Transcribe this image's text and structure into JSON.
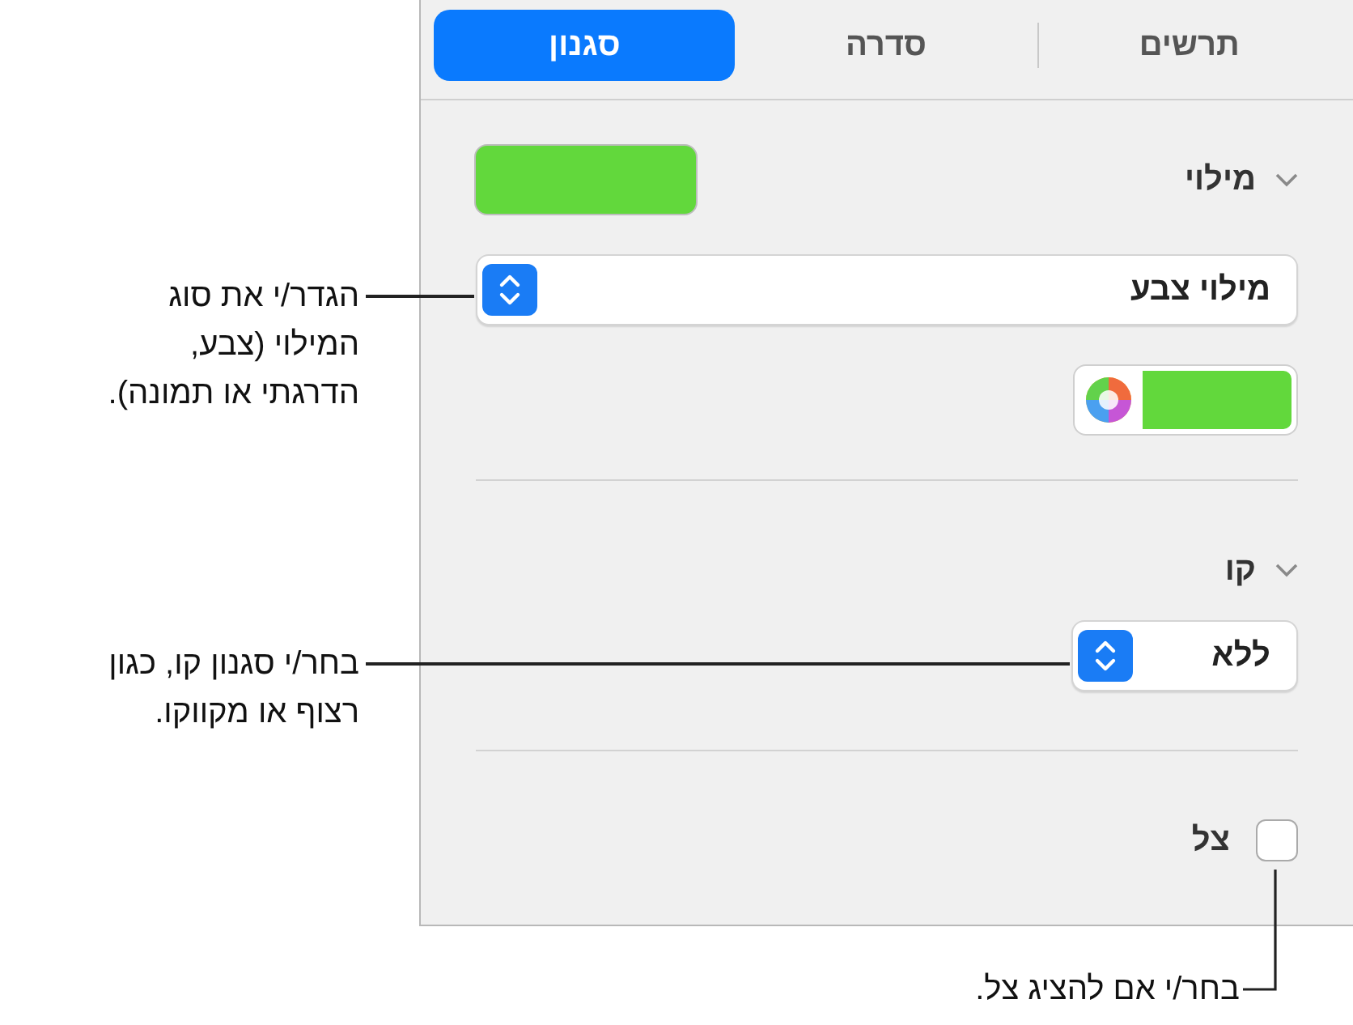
{
  "tabs": [
    {
      "label": "תרשים",
      "selected": false
    },
    {
      "label": "סדרה",
      "selected": false
    },
    {
      "label": "סגנון",
      "selected": true
    }
  ],
  "fill": {
    "label": "מילוי",
    "expanded": true,
    "type_popup": {
      "value": "מילוי צבע"
    }
  },
  "line": {
    "label": "קו",
    "expanded": true,
    "style_popup": {
      "value": "ללא"
    }
  },
  "shadow": {
    "label": "צל",
    "checked": false
  },
  "callouts": [
    {
      "text": "הגדר/י את סוג\nהמילוי (צבע,\nהדרגתי או תמונה)."
    },
    {
      "text": "בחר/י סגנון קו, כגון\nרצוף או מקווקו."
    },
    {
      "text": "בחר/י אם להציג צל."
    }
  ]
}
